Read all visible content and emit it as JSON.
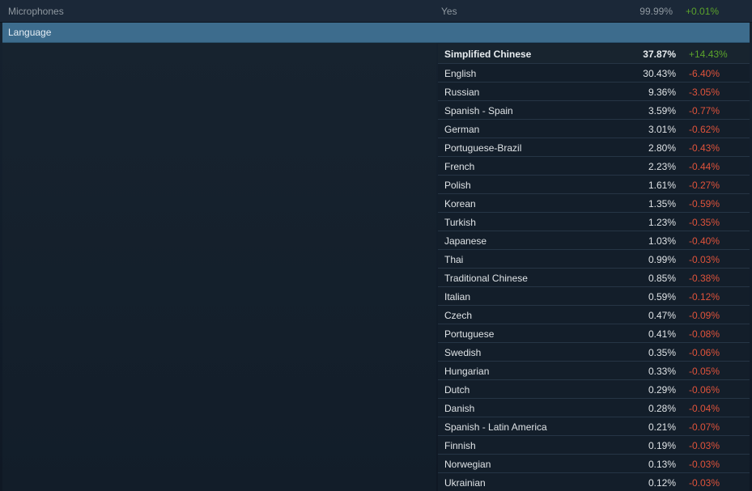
{
  "top_row": {
    "category": "Microphones",
    "value": "Yes",
    "percent": "99.99%",
    "change": "+0.01%"
  },
  "section": {
    "title": "Language"
  },
  "colors": {
    "header_bg": "#3d6c8d",
    "positive": "#5ba32b",
    "negative": "#e0533b"
  },
  "languages": [
    {
      "name": "Simplified Chinese",
      "percent": "37.87%",
      "change": "+14.43%"
    },
    {
      "name": "English",
      "percent": "30.43%",
      "change": "-6.40%"
    },
    {
      "name": "Russian",
      "percent": "9.36%",
      "change": "-3.05%"
    },
    {
      "name": "Spanish - Spain",
      "percent": "3.59%",
      "change": "-0.77%"
    },
    {
      "name": "German",
      "percent": "3.01%",
      "change": "-0.62%"
    },
    {
      "name": "Portuguese-Brazil",
      "percent": "2.80%",
      "change": "-0.43%"
    },
    {
      "name": "French",
      "percent": "2.23%",
      "change": "-0.44%"
    },
    {
      "name": "Polish",
      "percent": "1.61%",
      "change": "-0.27%"
    },
    {
      "name": "Korean",
      "percent": "1.35%",
      "change": "-0.59%"
    },
    {
      "name": "Turkish",
      "percent": "1.23%",
      "change": "-0.35%"
    },
    {
      "name": "Japanese",
      "percent": "1.03%",
      "change": "-0.40%"
    },
    {
      "name": "Thai",
      "percent": "0.99%",
      "change": "-0.03%"
    },
    {
      "name": "Traditional Chinese",
      "percent": "0.85%",
      "change": "-0.38%"
    },
    {
      "name": "Italian",
      "percent": "0.59%",
      "change": "-0.12%"
    },
    {
      "name": "Czech",
      "percent": "0.47%",
      "change": "-0.09%"
    },
    {
      "name": "Portuguese",
      "percent": "0.41%",
      "change": "-0.08%"
    },
    {
      "name": "Swedish",
      "percent": "0.35%",
      "change": "-0.06%"
    },
    {
      "name": "Hungarian",
      "percent": "0.33%",
      "change": "-0.05%"
    },
    {
      "name": "Dutch",
      "percent": "0.29%",
      "change": "-0.06%"
    },
    {
      "name": "Danish",
      "percent": "0.28%",
      "change": "-0.04%"
    },
    {
      "name": "Spanish - Latin America",
      "percent": "0.21%",
      "change": "-0.07%"
    },
    {
      "name": "Finnish",
      "percent": "0.19%",
      "change": "-0.03%"
    },
    {
      "name": "Norwegian",
      "percent": "0.13%",
      "change": "-0.03%"
    },
    {
      "name": "Ukrainian",
      "percent": "0.12%",
      "change": "-0.03%"
    }
  ]
}
